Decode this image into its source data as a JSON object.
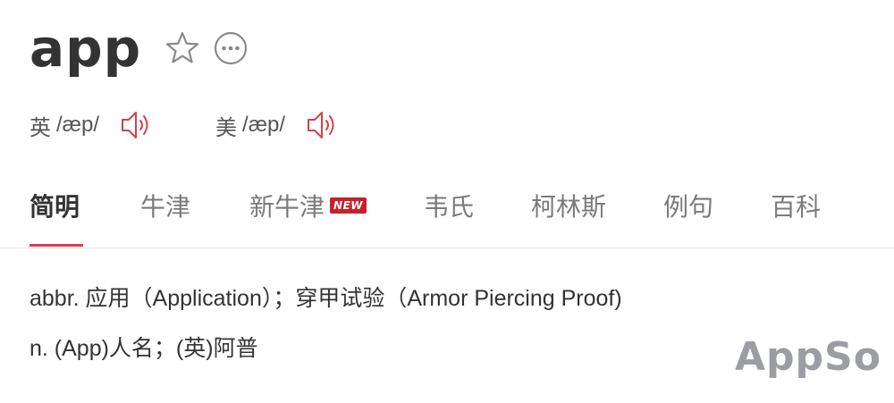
{
  "entry": {
    "word": "app",
    "icons": {
      "favorite": "star-icon",
      "more": "more-icon"
    }
  },
  "pronunciations": [
    {
      "region": "英",
      "phonetic": "/æp/",
      "icon": "speaker-icon"
    },
    {
      "region": "美",
      "phonetic": "/æp/",
      "icon": "speaker-icon"
    }
  ],
  "tabs": [
    {
      "label": "简明",
      "active": true
    },
    {
      "label": "牛津",
      "active": false
    },
    {
      "label": "新牛津",
      "active": false,
      "badge": "NEW"
    },
    {
      "label": "韦氏",
      "active": false
    },
    {
      "label": "柯林斯",
      "active": false
    },
    {
      "label": "例句",
      "active": false
    },
    {
      "label": "百科",
      "active": false
    }
  ],
  "definitions": [
    "abbr. 应用（Application）；穿甲试验（Armor Piercing Proof)",
    "n. (App)人名；(英)阿普"
  ],
  "watermark": "AppSo",
  "colors": {
    "accent": "#d6404a",
    "badge": "#c8202b",
    "text": "#333333",
    "muted": "#7a7a7a",
    "watermark": "#9b9da3"
  }
}
